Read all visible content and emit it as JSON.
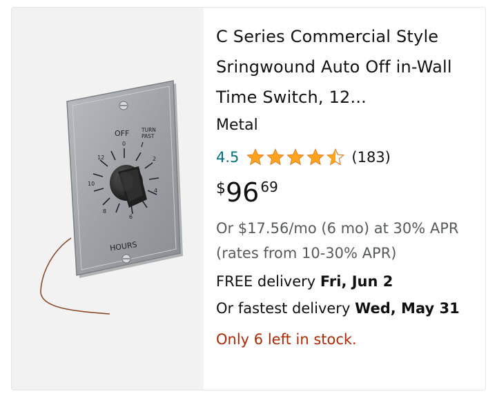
{
  "product": {
    "image_alt": "Wall time switch plate with dial",
    "plate_labels": {
      "off": "OFF",
      "turn_past": "TURN",
      "turn_past_2": "PAST",
      "hours": "HOURS",
      "dial_numbers": [
        "0",
        "2",
        "4",
        "6",
        "8",
        "10",
        "12"
      ]
    },
    "title": "C Series Commercial Style Sringwound Auto Off in-Wall Time Switch, 12...",
    "material": "Metal",
    "rating": {
      "value": "4.5",
      "stars": 4.5,
      "count": "(183)",
      "star_color": "#ffa41c"
    },
    "price": {
      "symbol": "$",
      "whole": "96",
      "fraction": "69"
    },
    "financing": "Or $17.56/mo (6 mo) at 30% APR (rates from 10-30% APR)",
    "delivery": {
      "prefix": "FREE delivery ",
      "date": "Fri, Jun 2"
    },
    "fastest": {
      "prefix": "Or fastest delivery ",
      "date": "Wed, May 31"
    },
    "stock": "Only 6 left in stock.",
    "colors": {
      "link": "#007185",
      "stock_warning": "#b12704"
    }
  }
}
